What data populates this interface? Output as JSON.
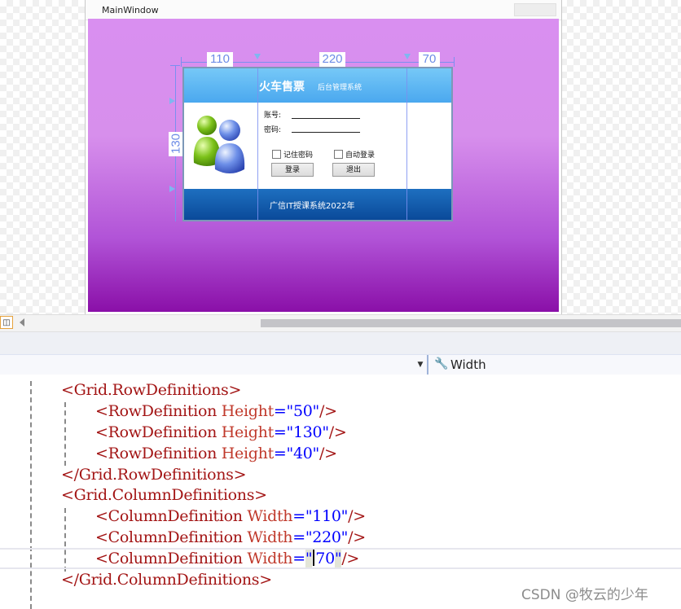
{
  "window": {
    "title": "MainWindow"
  },
  "grid_adorners": {
    "col1": "110",
    "col2": "220",
    "col3": "70",
    "row2": "130"
  },
  "login_panel": {
    "title": "火车售票",
    "subtitle": "后台管理系统",
    "account_label": "账号:",
    "password_label": "密码:",
    "remember_label": "记住密码",
    "autologin_label": "自动登录",
    "login_button": "登录",
    "exit_button": "退出",
    "footer": "广信IT授课系统2022年"
  },
  "properties": {
    "selected_property": "Width"
  },
  "code": {
    "lines": [
      {
        "open": "<",
        "tag": "Grid.RowDefinitions",
        "close": ">"
      },
      {
        "open": "<",
        "tag": "RowDefinition",
        "attr": "Height",
        "eq": "=",
        "val": "\"50\"",
        "close": "/>"
      },
      {
        "open": "<",
        "tag": "RowDefinition",
        "attr": "Height",
        "eq": "=",
        "val": "\"130\"",
        "close": "/>"
      },
      {
        "open": "<",
        "tag": "RowDefinition",
        "attr": "Height",
        "eq": "=",
        "val": "\"40\"",
        "close": "/>"
      },
      {
        "open": "</",
        "tag": "Grid.RowDefinitions",
        "close": ">"
      },
      {
        "open": "<",
        "tag": "Grid.ColumnDefinitions",
        "close": ">"
      },
      {
        "open": "<",
        "tag": "ColumnDefinition",
        "attr": "Width",
        "eq": "=",
        "val": "\"110\"",
        "close": "/>"
      },
      {
        "open": "<",
        "tag": "ColumnDefinition",
        "attr": "Width",
        "eq": "=",
        "val": "\"220\"",
        "close": "/>"
      },
      {
        "open": "<",
        "tag": "ColumnDefinition",
        "attr": "Width",
        "eq": "=",
        "val_open": "\"",
        "val_rest": "70",
        "val_close": "\"",
        "close": "/>"
      },
      {
        "open": "</",
        "tag": "Grid.ColumnDefinitions",
        "close": ">"
      }
    ]
  },
  "watermark": "CSDN @牧云的少年",
  "colors": {
    "gradient_top": "#d98ff0",
    "gradient_bottom": "#8a0fa8",
    "adorner": "#7b8ff0",
    "header_blue": "#4aa8ef",
    "footer_blue": "#0a4a9a"
  }
}
